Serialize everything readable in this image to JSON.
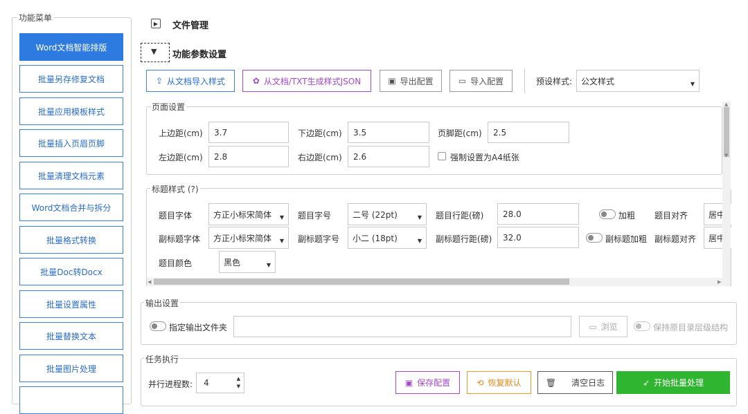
{
  "sidebar": {
    "title": "功能菜单",
    "items": [
      {
        "label": "Word文档智能排版"
      },
      {
        "label": "批量另存修复文档"
      },
      {
        "label": "批量应用模板样式"
      },
      {
        "label": "批量插入页眉页脚"
      },
      {
        "label": "批量清理文档元素"
      },
      {
        "label": "Word文档合并与拆分"
      },
      {
        "label": "批量格式转换"
      },
      {
        "label": "批量Doc转Docx"
      },
      {
        "label": "批量设置属性"
      },
      {
        "label": "批量替换文本"
      },
      {
        "label": "批量图片处理"
      }
    ]
  },
  "sections": {
    "file_manage": "文件管理",
    "params": "功能参数设置"
  },
  "toolbar": {
    "import_from_doc": "从文档导入样式",
    "gen_json": "从文档/TXT生成样式JSON",
    "export_config": "导出配置",
    "import_config": "导入配置",
    "preset_label": "预设样式:",
    "preset_value": "公文样式"
  },
  "page_setup": {
    "title": "页面设置",
    "top_margin_label": "上边距(cm)",
    "top_margin": "3.7",
    "bottom_margin_label": "下边距(cm)",
    "bottom_margin": "3.5",
    "footer_label": "页脚距(cm)",
    "footer": "2.5",
    "left_margin_label": "左边距(cm)",
    "left_margin": "2.8",
    "right_margin_label": "右边距(cm)",
    "right_margin": "2.6",
    "force_a4_label": "强制设置为A4纸张"
  },
  "title_style": {
    "title": "标题样式 (?)",
    "font_label": "题目字体",
    "font": "方正小标宋简体",
    "size_label": "题目字号",
    "size": "二号 (22pt)",
    "spacing_label": "题目行距(磅)",
    "spacing": "28.0",
    "bold_label": "加粗",
    "align_label": "题目对齐",
    "align": "居中",
    "sub_font_label": "副标题字体",
    "sub_font": "方正小标宋简体",
    "sub_size_label": "副标题字号",
    "sub_size": "小二 (18pt)",
    "sub_spacing_label": "副标题行距(磅)",
    "sub_spacing": "32.0",
    "sub_bold_label": "副标题加粗",
    "sub_align_label": "副标题对齐",
    "sub_align": "居中",
    "color_label": "题目颜色",
    "color": "黑色"
  },
  "output": {
    "title": "输出设置",
    "specify_folder_label": "指定输出文件夹",
    "folder_path": "",
    "browse": "浏览",
    "keep_structure_label": "保持原目录层级结构"
  },
  "task": {
    "title": "任务执行",
    "parallel_label": "并行进程数:",
    "parallel_value": "4",
    "save_config": "保存配置",
    "restore_default": "恢复默认",
    "clear_log": "清空日志",
    "start": "开始批量处理"
  },
  "colors": {
    "accent_blue": "#2d7be0",
    "purple": "#a348c9",
    "orange": "#e89a2c",
    "green": "#2fb52f"
  }
}
